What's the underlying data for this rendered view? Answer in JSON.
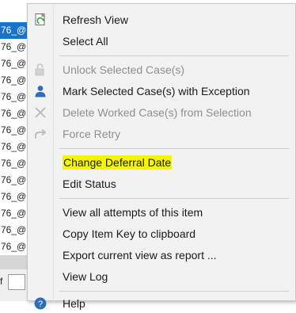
{
  "background_list": {
    "rows": [
      "76_@",
      "76_@",
      "76_@",
      "76_@",
      "76_@",
      "76_@",
      "76_@",
      "76_@",
      "76_@",
      "76_@",
      "76_@",
      "76_@",
      "76_@",
      "76_@"
    ],
    "footer_label": "f"
  },
  "menu": {
    "items": [
      {
        "label": "Refresh View",
        "icon": "refresh-view-icon"
      },
      {
        "label": "Select All",
        "icon": ""
      },
      {
        "label": "Unlock Selected Case(s)",
        "icon": "unlock-icon"
      },
      {
        "label": "Mark Selected Case(s) with Exception",
        "icon": "user-icon"
      },
      {
        "label": "Delete Worked Case(s) from Selection",
        "icon": "close-icon"
      },
      {
        "label": "Force Retry",
        "icon": "retry-arrow-icon"
      },
      {
        "label": "Change Deferral Date",
        "icon": ""
      },
      {
        "label": "Edit Status",
        "icon": ""
      },
      {
        "label": "View all attempts of this item",
        "icon": ""
      },
      {
        "label": "Copy Item Key to clipboard",
        "icon": ""
      },
      {
        "label": "Export current view as report ...",
        "icon": ""
      },
      {
        "label": "View Log",
        "icon": ""
      },
      {
        "label": "Help",
        "icon": "help-icon"
      }
    ]
  },
  "colors": {
    "selection_blue": "#1a73c9",
    "highlight_yellow": "#f6f600",
    "disabled_text": "#8f8f8f",
    "icon_blue": "#2f6db5"
  }
}
